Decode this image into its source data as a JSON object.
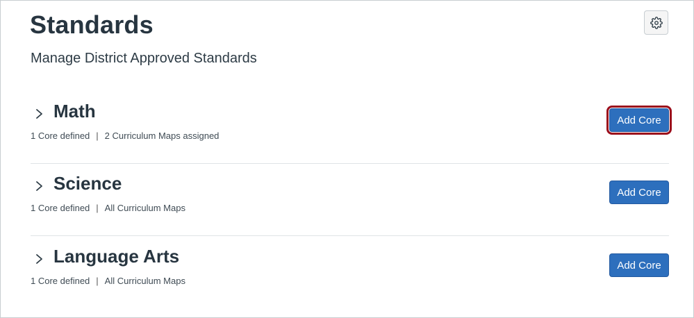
{
  "page": {
    "title": "Standards",
    "subtitle": "Manage District Approved Standards",
    "settings_icon": "gear-icon"
  },
  "sections": [
    {
      "name": "Math",
      "core_defined": "1 Core defined",
      "separator": "|",
      "maps": "2 Curriculum Maps assigned",
      "button_label": "Add Core",
      "button_focused": true
    },
    {
      "name": "Science",
      "core_defined": "1 Core defined",
      "separator": "|",
      "maps": "All Curriculum Maps",
      "button_label": "Add Core",
      "button_focused": false
    },
    {
      "name": "Language Arts",
      "core_defined": "1 Core defined",
      "separator": "|",
      "maps": "All Curriculum Maps",
      "button_label": "Add Core",
      "button_focused": false
    }
  ],
  "colors": {
    "button_bg": "#2d6fbd",
    "focus_ring": "#9b0d1b",
    "title_text": "#273540"
  }
}
